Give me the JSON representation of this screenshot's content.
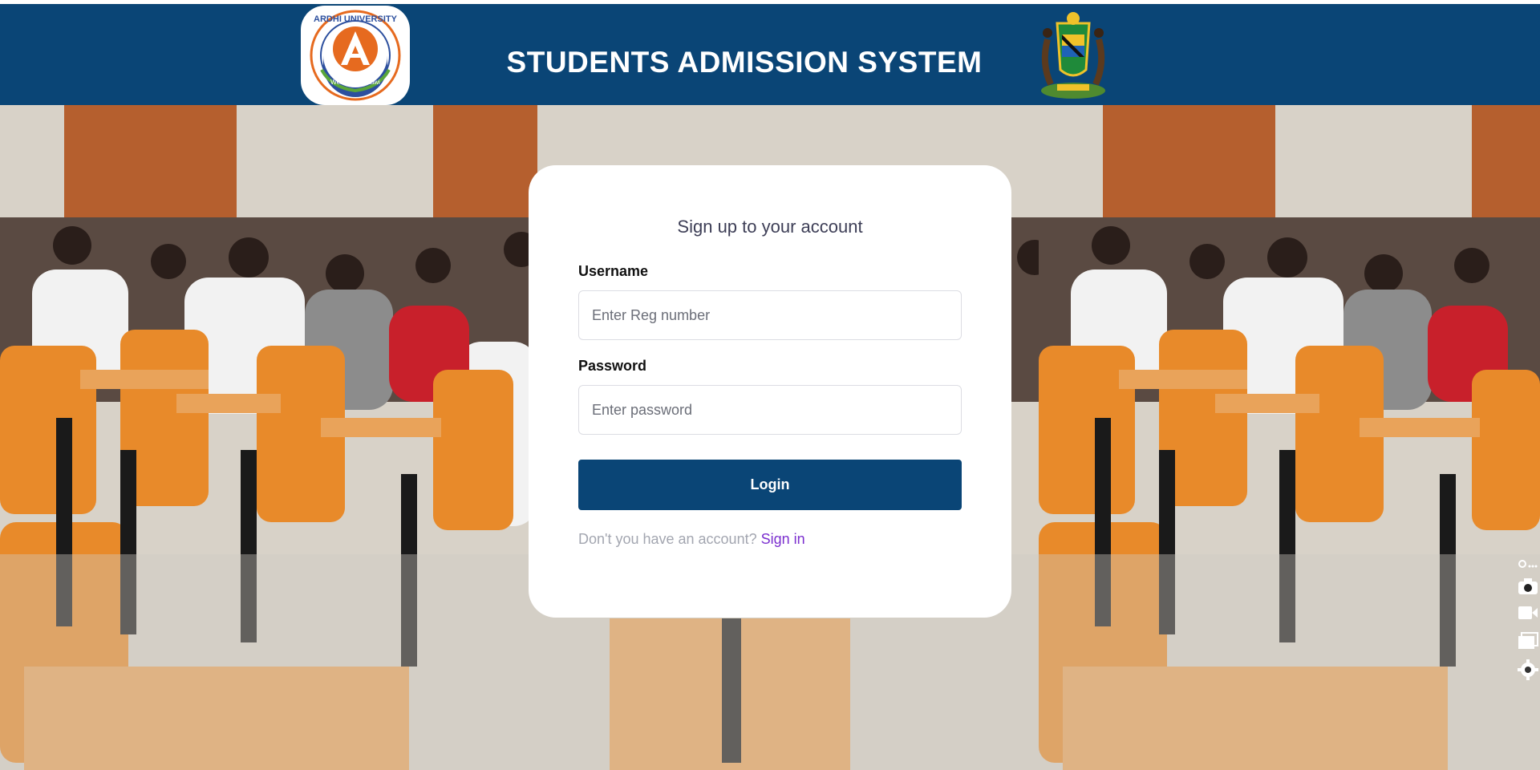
{
  "header": {
    "title": "STUDENTS ADMISSION SYSTEM",
    "left_logo": {
      "icon": "ardhi-university-logo-icon",
      "text": "ARDHI UNIVERSITY",
      "motto": "Weledi na Ustawi"
    },
    "right_logo": {
      "icon": "tanzania-coat-of-arms-icon"
    },
    "background_color": "#0a4576"
  },
  "background": {
    "description_icon": "classroom-students-photo"
  },
  "login_card": {
    "title": "Sign up to your account",
    "username_label": "Username",
    "username_placeholder": "Enter Reg number",
    "username_value": "",
    "password_label": "Password",
    "password_placeholder": "Enter password",
    "password_value": "",
    "login_button": "Login",
    "signup_prompt": "Don't you have an account?",
    "signin_link": "Sign in"
  },
  "side_toolbar": {
    "icons": [
      "extension-icon",
      "camera-icon",
      "video-icon",
      "window-icon",
      "settings-icon"
    ],
    "top_label": "..."
  },
  "colors": {
    "primary": "#0a4576",
    "link": "#7b2fcf",
    "prompt_text": "#a3a6b0"
  }
}
